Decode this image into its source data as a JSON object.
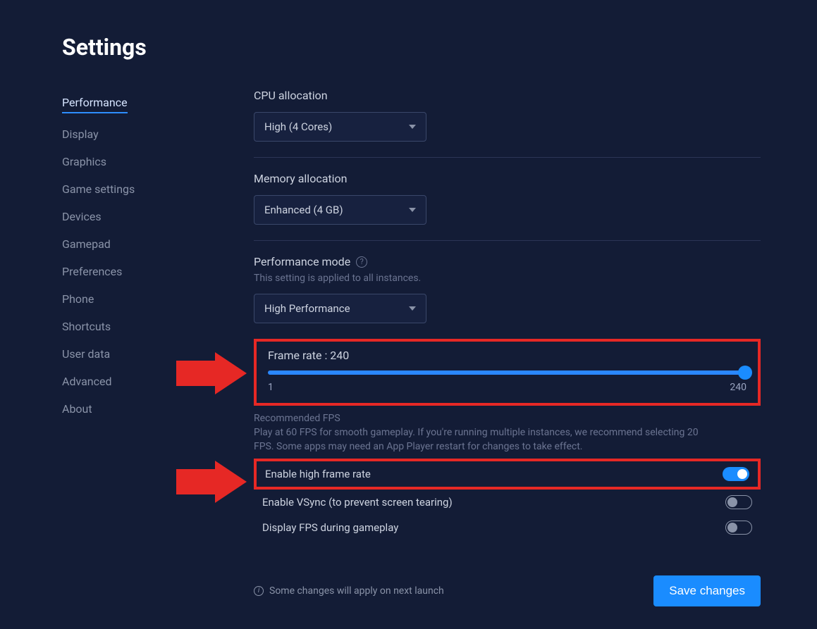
{
  "title": "Settings",
  "sidebar": {
    "items": [
      {
        "label": "Performance",
        "active": true
      },
      {
        "label": "Display"
      },
      {
        "label": "Graphics"
      },
      {
        "label": "Game settings"
      },
      {
        "label": "Devices"
      },
      {
        "label": "Gamepad"
      },
      {
        "label": "Preferences"
      },
      {
        "label": "Phone"
      },
      {
        "label": "Shortcuts"
      },
      {
        "label": "User data"
      },
      {
        "label": "Advanced"
      },
      {
        "label": "About"
      }
    ]
  },
  "cpu": {
    "label": "CPU allocation",
    "value": "High (4 Cores)"
  },
  "memory": {
    "label": "Memory allocation",
    "value": "Enhanced (4 GB)"
  },
  "perfmode": {
    "label": "Performance mode",
    "sublabel": "This setting is applied to all instances.",
    "value": "High Performance"
  },
  "framerate": {
    "label": "Frame rate : 240",
    "min": "1",
    "max": "240",
    "recommended_title": "Recommended FPS",
    "recommended_text": "Play at 60 FPS for smooth gameplay. If you're running multiple instances, we recommend selecting 20 FPS. Some apps may need an App Player restart for changes to take effect."
  },
  "toggles": {
    "high_fps": "Enable high frame rate",
    "vsync": "Enable VSync (to prevent screen tearing)",
    "display_fps": "Display FPS during gameplay"
  },
  "footer": {
    "note": "Some changes will apply on next launch",
    "save": "Save changes"
  }
}
